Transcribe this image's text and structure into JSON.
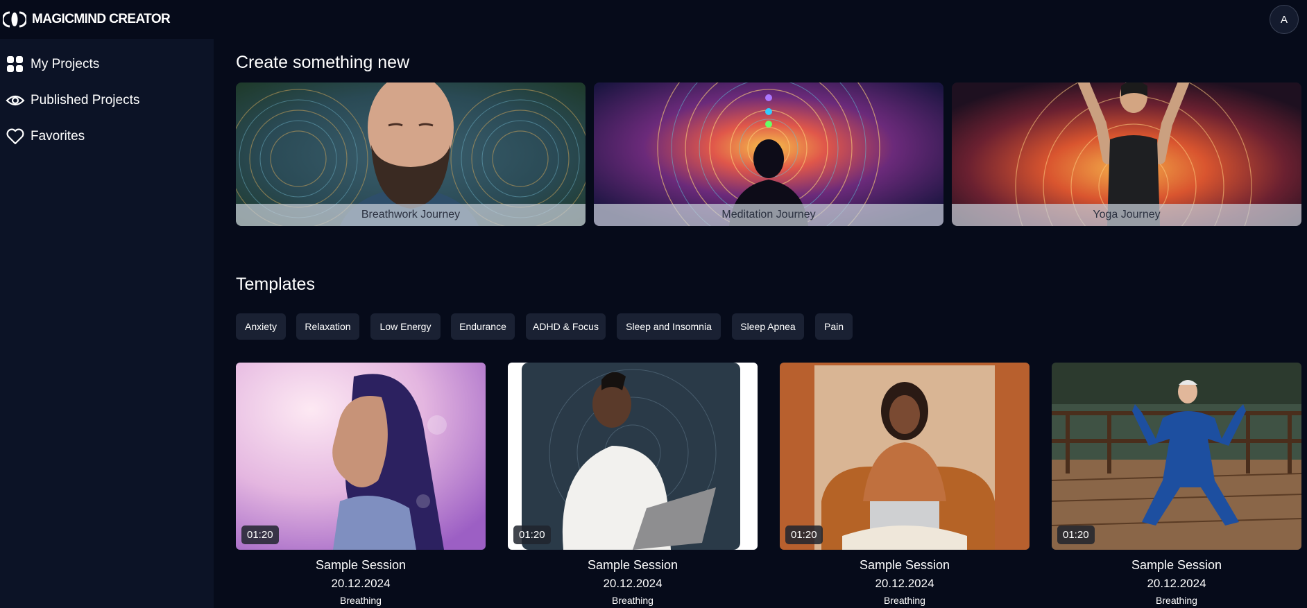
{
  "app": {
    "name": "MAGICMIND CREATOR",
    "avatar_initial": "A"
  },
  "sidebar": {
    "items": [
      {
        "label": "My Projects",
        "icon": "grid-icon"
      },
      {
        "label": "Published Projects",
        "icon": "eye-icon"
      },
      {
        "label": "Favorites",
        "icon": "heart-icon"
      }
    ]
  },
  "create": {
    "title": "Create something new",
    "journeys": [
      {
        "label": "Breathwork Journey"
      },
      {
        "label": "Meditation Journey"
      },
      {
        "label": "Yoga Journey"
      }
    ]
  },
  "templates": {
    "title": "Templates",
    "filters": [
      "Anxiety",
      "Relaxation",
      "Low Energy",
      "Endurance",
      "ADHD & Focus",
      "Sleep and Insomnia",
      "Sleep Apnea",
      "Pain"
    ],
    "cards": [
      {
        "duration": "01:20",
        "title": "Sample Session",
        "date": "20.12.2024",
        "category": "Breathing"
      },
      {
        "duration": "01:20",
        "title": "Sample Session",
        "date": "20.12.2024",
        "category": "Breathing"
      },
      {
        "duration": "01:20",
        "title": "Sample Session",
        "date": "20.12.2024",
        "category": "Breathing"
      },
      {
        "duration": "01:20",
        "title": "Sample Session",
        "date": "20.12.2024",
        "category": "Breathing"
      }
    ]
  },
  "colors": {
    "background": "#060b1a",
    "sidebar": "#0c1326",
    "chip": "#1a2133"
  }
}
